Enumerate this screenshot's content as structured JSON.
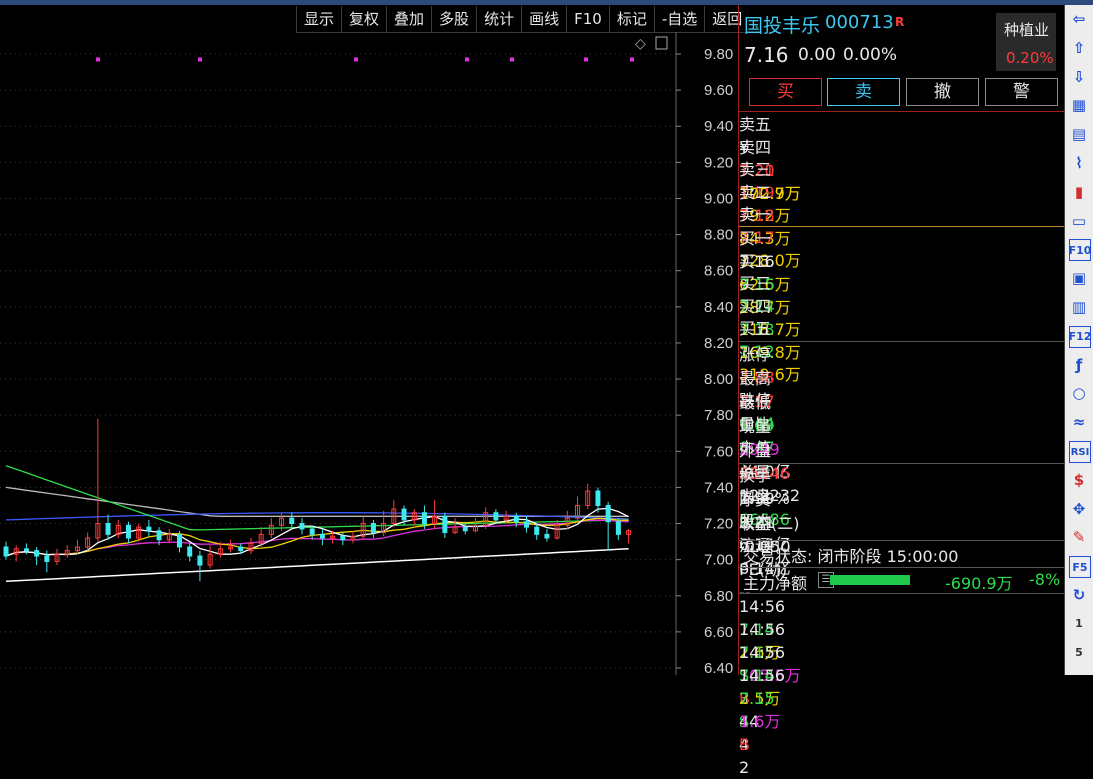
{
  "toolbar": [
    "显示",
    "复权",
    "叠加",
    "多股",
    "统计",
    "画线",
    "F10",
    "标记",
    "-自选",
    "返回"
  ],
  "axis_ticks": [
    "9.80",
    "9.60",
    "9.40",
    "9.20",
    "9.00",
    "8.80",
    "8.60",
    "8.40",
    "8.20",
    "8.00",
    "7.80",
    "7.60",
    "7.40",
    "7.20",
    "7.00",
    "6.80",
    "6.60",
    "6.40"
  ],
  "stock": {
    "name": "国投丰乐",
    "code": "000713",
    "flag": "R",
    "price": "7.16",
    "change": "0.00",
    "pct": "0.00%",
    "industry": "种植业",
    "industry_pct": "0.20%"
  },
  "trade_buttons": [
    "买",
    "卖",
    "撤",
    "警"
  ],
  "asks": [
    {
      "label": "卖五",
      "sym": "¥",
      "price": "7.21",
      "vol": "102.7万"
    },
    {
      "label": "卖四",
      "price": "7.20",
      "vol": "170.9万"
    },
    {
      "label": "卖三",
      "price": "7.19",
      "vol": "79.2万"
    },
    {
      "label": "卖二",
      "price": "7.18",
      "vol": "84.3万"
    },
    {
      "label": "卖一",
      "price": "7.17",
      "vol": "128.0万"
    }
  ],
  "bids": [
    {
      "label": "买一",
      "price": "7.16",
      "vol": "62.6万"
    },
    {
      "label": "买二",
      "price": "7.15",
      "vol": "28.7万"
    },
    {
      "label": "买三",
      "price": "7.14",
      "vol": "118.7万"
    },
    {
      "label": "买四",
      "price": "7.13",
      "vol": "169.8万"
    },
    {
      "label": "买五",
      "price": "7.12",
      "vol": "319.6万"
    }
  ],
  "stats1": [
    {
      "l1": "涨停",
      "v1": "7.88",
      "l2": "跌停",
      "v2": "6.44"
    },
    {
      "l1": "最高",
      "v1": "7.17",
      "l2": "量比",
      "v2": "0.47"
    },
    {
      "l1": "最低",
      "v1": "7.09",
      "l2": "市值",
      "v2": "44.0亿"
    },
    {
      "l1": "现量",
      "v1": "2949",
      "l2": "总量",
      "v2": "122232"
    },
    {
      "l1": "外盘",
      "v1": "55546",
      "l2": "内盘",
      "v2": "66686"
    }
  ],
  "stats2": [
    {
      "l1": "换手",
      "v1": "1.99%",
      "l2": "股本",
      "v2": "6.14亿"
    },
    {
      "l1": "净资",
      "v1": "3.21",
      "l2": "流通",
      "v2": "6.14亿"
    },
    {
      "l1": "收益(二)",
      "v1": "-0.050",
      "l2": "PE(动)",
      "v2": "--"
    }
  ],
  "trade_status": "交易状态: 闭市阶段 15:00:00",
  "main_flow": {
    "label": "主力净额",
    "value": "-690.9万",
    "pct": "-8%",
    "bar_fraction": 0.08
  },
  "ticks": [
    {
      "time": "14:56",
      "price": "7.14",
      "vol": "2.6万",
      "side": "S",
      "n": "3"
    },
    {
      "time": "14:56",
      "price": "7.15",
      "vol": "105.5万",
      "side": "B",
      "n": "44"
    },
    {
      "time": "14:56",
      "price": "7.14",
      "vol": "2.5万",
      "side": "S",
      "n": "4"
    },
    {
      "time": "14:56",
      "price": "7.15",
      "vol": "1.6万",
      "side": "B",
      "n": "2"
    }
  ],
  "sidebar_icons": [
    "back-arrow-icon",
    "up-arrow-icon",
    "down-arrow-icon",
    "report-icon",
    "grid-icon",
    "line-chart-icon",
    "candle-chart-icon",
    "news-icon",
    "f10-icon",
    "list-icon",
    "finance-icon",
    "f12-icon",
    "formula-icon",
    "circle-icon",
    "indicator-icon",
    "rsi-icon",
    "dollar-icon",
    "move-icon",
    "pencil-icon",
    "f5-icon",
    "refresh-icon",
    "page-1",
    "page-5"
  ],
  "sidebar_labels": {
    "f10-icon": "F10",
    "f12-icon": "F12",
    "rsi-icon": "RSI",
    "f5-icon": "F5",
    "page-1": "1",
    "page-5": "5"
  },
  "colors": {
    "up": "#ff3b3b",
    "down": "#2fdc4a",
    "ma5": "#ffffff",
    "ma10": "#f0d000",
    "ma20": "#e030e0",
    "ma30": "#2fdc4a",
    "ma60": "#3a5aff",
    "ma120": "#bbbbbb",
    "ma250": "#ffffff"
  },
  "chart_data": {
    "type": "candlestick",
    "y_axis_ticks": [
      9.8,
      9.6,
      9.4,
      9.2,
      9.0,
      8.8,
      8.6,
      8.4,
      8.2,
      8.0,
      7.8,
      7.6,
      7.4,
      7.2,
      7.0,
      6.8,
      6.6,
      6.4
    ],
    "ylim": [
      6.4,
      9.85
    ],
    "markers_y": 9.77,
    "candles": [
      [
        7.07,
        7.02,
        7.1,
        7.0
      ],
      [
        7.03,
        7.06,
        7.08,
        6.99
      ],
      [
        7.06,
        7.05,
        7.09,
        7.03
      ],
      [
        7.05,
        7.02,
        7.07,
        6.97
      ],
      [
        7.02,
        6.99,
        7.05,
        6.93
      ],
      [
        6.99,
        7.03,
        7.06,
        6.97
      ],
      [
        7.03,
        7.05,
        7.08,
        7.01
      ],
      [
        7.05,
        7.07,
        7.11,
        7.03
      ],
      [
        7.07,
        7.12,
        7.15,
        7.05
      ],
      [
        7.12,
        7.2,
        7.78,
        7.1
      ],
      [
        7.2,
        7.14,
        7.25,
        7.11
      ],
      [
        7.14,
        7.19,
        7.22,
        7.12
      ],
      [
        7.19,
        7.12,
        7.21,
        7.09
      ],
      [
        7.12,
        7.18,
        7.2,
        7.1
      ],
      [
        7.18,
        7.16,
        7.22,
        7.13
      ],
      [
        7.16,
        7.11,
        7.18,
        7.08
      ],
      [
        7.11,
        7.14,
        7.17,
        7.09
      ],
      [
        7.14,
        7.07,
        7.16,
        7.04
      ],
      [
        7.07,
        7.02,
        7.09,
        6.99
      ],
      [
        7.02,
        6.97,
        7.05,
        6.88
      ],
      [
        6.97,
        7.03,
        7.08,
        6.95
      ],
      [
        7.03,
        7.06,
        7.1,
        7.01
      ],
      [
        7.06,
        7.07,
        7.11,
        7.04
      ],
      [
        7.07,
        7.05,
        7.09,
        7.03
      ],
      [
        7.05,
        7.09,
        7.12,
        7.03
      ],
      [
        7.09,
        7.14,
        7.18,
        7.07
      ],
      [
        7.14,
        7.19,
        7.23,
        7.12
      ],
      [
        7.19,
        7.23,
        7.26,
        7.16
      ],
      [
        7.23,
        7.2,
        7.26,
        7.17
      ],
      [
        7.2,
        7.17,
        7.23,
        7.14
      ],
      [
        7.17,
        7.14,
        7.19,
        7.11
      ],
      [
        7.14,
        7.12,
        7.17,
        7.08
      ],
      [
        7.12,
        7.13,
        7.16,
        7.09
      ],
      [
        7.13,
        7.11,
        7.15,
        7.08
      ],
      [
        7.11,
        7.13,
        7.16,
        7.09
      ],
      [
        7.13,
        7.2,
        7.24,
        7.11
      ],
      [
        7.2,
        7.15,
        7.22,
        7.12
      ],
      [
        7.15,
        7.2,
        7.27,
        7.13
      ],
      [
        7.2,
        7.28,
        7.33,
        7.18
      ],
      [
        7.28,
        7.22,
        7.3,
        7.19
      ],
      [
        7.22,
        7.26,
        7.28,
        7.19
      ],
      [
        7.26,
        7.2,
        7.3,
        7.17
      ],
      [
        7.2,
        7.24,
        7.33,
        7.17
      ],
      [
        7.24,
        7.15,
        7.26,
        7.12
      ],
      [
        7.15,
        7.18,
        7.23,
        7.14
      ],
      [
        7.18,
        7.16,
        7.21,
        7.14
      ],
      [
        7.16,
        7.19,
        7.23,
        7.15
      ],
      [
        7.19,
        7.26,
        7.29,
        7.17
      ],
      [
        7.26,
        7.22,
        7.28,
        7.2
      ],
      [
        7.22,
        7.24,
        7.27,
        7.2
      ],
      [
        7.24,
        7.21,
        7.26,
        7.18
      ],
      [
        7.21,
        7.18,
        7.24,
        7.15
      ],
      [
        7.18,
        7.14,
        7.2,
        7.11
      ],
      [
        7.14,
        7.12,
        7.17,
        7.1
      ],
      [
        7.12,
        7.19,
        7.22,
        7.11
      ],
      [
        7.19,
        7.23,
        7.27,
        7.17
      ],
      [
        7.23,
        7.3,
        7.35,
        7.21
      ],
      [
        7.3,
        7.38,
        7.42,
        7.28
      ],
      [
        7.38,
        7.3,
        7.4,
        7.26
      ],
      [
        7.3,
        7.21,
        7.32,
        7.05
      ],
      [
        7.21,
        7.14,
        7.23,
        7.11
      ],
      [
        7.14,
        7.16,
        7.17,
        7.09
      ]
    ]
  }
}
